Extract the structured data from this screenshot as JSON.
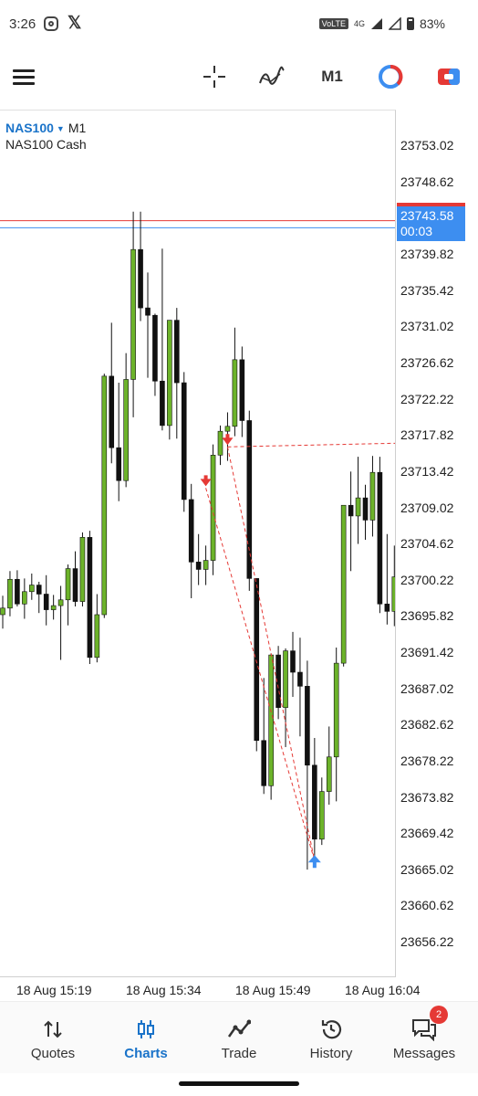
{
  "status_bar": {
    "time": "3:26",
    "network": "4G",
    "volte": "VoLTE",
    "battery": "83%"
  },
  "toolbar": {
    "timeframe": "M1"
  },
  "chart_header": {
    "symbol": "NAS100",
    "timeframe": "M1",
    "description": "NAS100 Cash"
  },
  "price_scale": {
    "labels": [
      "23753.02",
      "23748.62",
      "23739.82",
      "23735.42",
      "23731.02",
      "23726.62",
      "23722.22",
      "23717.82",
      "23713.42",
      "23709.02",
      "23704.62",
      "23700.22",
      "23695.82",
      "23691.42",
      "23687.02",
      "23682.62",
      "23678.22",
      "23673.82",
      "23669.42",
      "23665.02",
      "23660.62",
      "23656.22"
    ],
    "current_price": "23743.58",
    "countdown": "00:03"
  },
  "time_axis": {
    "labels": [
      "18 Aug 15:19",
      "18 Aug 15:34",
      "18 Aug 15:49",
      "18 Aug 16:04"
    ]
  },
  "colors": {
    "bull": "#6cb32a",
    "bear": "#111111",
    "ask_line": "#e53935",
    "bid_line": "#3d8ef0",
    "trade_line": "#e53935",
    "buy_arrow": "#3d8ef0",
    "sell_arrow": "#e53935",
    "accent": "#1a73c9"
  },
  "chart_data": {
    "type": "candlestick",
    "y_axis": {
      "min": 23652.0,
      "max": 23757.5
    },
    "ask_price": 23744.0,
    "bid_price": 23743.58,
    "candles": [
      {
        "o": 23696.2,
        "h": 23698.5,
        "l": 23694.5,
        "c": 23697.0
      },
      {
        "o": 23697.0,
        "h": 23701.5,
        "l": 23696.0,
        "c": 23700.5
      },
      {
        "o": 23700.5,
        "h": 23701.6,
        "l": 23697.2,
        "c": 23697.5
      },
      {
        "o": 23697.5,
        "h": 23700.6,
        "l": 23695.7,
        "c": 23699.0
      },
      {
        "o": 23699.0,
        "h": 23701.2,
        "l": 23698.0,
        "c": 23699.8
      },
      {
        "o": 23699.8,
        "h": 23700.2,
        "l": 23696.4,
        "c": 23698.7
      },
      {
        "o": 23698.7,
        "h": 23701.0,
        "l": 23694.9,
        "c": 23696.8
      },
      {
        "o": 23696.8,
        "h": 23698.6,
        "l": 23695.6,
        "c": 23697.3
      },
      {
        "o": 23697.3,
        "h": 23699.7,
        "l": 23690.7,
        "c": 23698.0
      },
      {
        "o": 23698.0,
        "h": 23702.3,
        "l": 23694.9,
        "c": 23701.8
      },
      {
        "o": 23701.8,
        "h": 23703.9,
        "l": 23697.2,
        "c": 23697.8
      },
      {
        "o": 23697.8,
        "h": 23706.2,
        "l": 23697.2,
        "c": 23705.6
      },
      {
        "o": 23705.6,
        "h": 23706.4,
        "l": 23690.2,
        "c": 23691.0
      },
      {
        "o": 23691.0,
        "h": 23698.7,
        "l": 23690.4,
        "c": 23696.2
      },
      {
        "o": 23696.2,
        "h": 23725.5,
        "l": 23695.8,
        "c": 23725.2
      },
      {
        "o": 23725.2,
        "h": 23731.7,
        "l": 23714.6,
        "c": 23716.5
      },
      {
        "o": 23716.5,
        "h": 23724.4,
        "l": 23710.0,
        "c": 23712.5
      },
      {
        "o": 23712.5,
        "h": 23728.0,
        "l": 23711.7,
        "c": 23724.8
      },
      {
        "o": 23724.8,
        "h": 23745.2,
        "l": 23720.2,
        "c": 23740.6
      },
      {
        "o": 23740.6,
        "h": 23745.2,
        "l": 23731.9,
        "c": 23733.5
      },
      {
        "o": 23733.5,
        "h": 23737.8,
        "l": 23725.0,
        "c": 23732.6
      },
      {
        "o": 23732.6,
        "h": 23732.8,
        "l": 23722.8,
        "c": 23724.6
      },
      {
        "o": 23724.6,
        "h": 23740.7,
        "l": 23718.6,
        "c": 23719.2
      },
      {
        "o": 23719.2,
        "h": 23731.2,
        "l": 23717.5,
        "c": 23732.0
      },
      {
        "o": 23732.0,
        "h": 23733.5,
        "l": 23717.6,
        "c": 23724.4
      },
      {
        "o": 23724.4,
        "h": 23725.7,
        "l": 23708.7,
        "c": 23710.2
      },
      {
        "o": 23710.2,
        "h": 23712.1,
        "l": 23698.2,
        "c": 23702.6
      },
      {
        "o": 23702.6,
        "h": 23706.0,
        "l": 23699.8,
        "c": 23701.7
      },
      {
        "o": 23701.7,
        "h": 23704.6,
        "l": 23699.8,
        "c": 23702.8
      },
      {
        "o": 23702.8,
        "h": 23716.9,
        "l": 23701.0,
        "c": 23715.6
      },
      {
        "o": 23715.6,
        "h": 23719.2,
        "l": 23714.4,
        "c": 23718.5
      },
      {
        "o": 23718.5,
        "h": 23720.8,
        "l": 23714.9,
        "c": 23719.1
      },
      {
        "o": 23719.1,
        "h": 23731.1,
        "l": 23717.9,
        "c": 23727.2
      },
      {
        "o": 23727.2,
        "h": 23728.8,
        "l": 23717.8,
        "c": 23719.8
      },
      {
        "o": 23719.8,
        "h": 23721.0,
        "l": 23699.1,
        "c": 23700.6
      },
      {
        "o": 23700.6,
        "h": 23698.6,
        "l": 23679.6,
        "c": 23680.9
      },
      {
        "o": 23680.9,
        "h": 23688.5,
        "l": 23674.4,
        "c": 23675.4
      },
      {
        "o": 23675.4,
        "h": 23691.5,
        "l": 23673.7,
        "c": 23691.3
      },
      {
        "o": 23691.3,
        "h": 23692.4,
        "l": 23683.5,
        "c": 23684.9
      },
      {
        "o": 23684.9,
        "h": 23692.1,
        "l": 23680.1,
        "c": 23691.8
      },
      {
        "o": 23691.8,
        "h": 23694.1,
        "l": 23686.2,
        "c": 23689.2
      },
      {
        "o": 23689.2,
        "h": 23693.4,
        "l": 23681.4,
        "c": 23687.5
      },
      {
        "o": 23687.5,
        "h": 23690.6,
        "l": 23665.2,
        "c": 23677.9
      },
      {
        "o": 23677.9,
        "h": 23681.2,
        "l": 23666.0,
        "c": 23668.9
      },
      {
        "o": 23668.9,
        "h": 23676.4,
        "l": 23668.2,
        "c": 23674.7
      },
      {
        "o": 23674.7,
        "h": 23682.6,
        "l": 23673.1,
        "c": 23678.9
      },
      {
        "o": 23678.9,
        "h": 23692.2,
        "l": 23673.5,
        "c": 23690.3
      },
      {
        "o": 23690.3,
        "h": 23705.2,
        "l": 23689.9,
        "c": 23709.5
      },
      {
        "o": 23709.5,
        "h": 23713.6,
        "l": 23701.5,
        "c": 23708.2
      },
      {
        "o": 23708.2,
        "h": 23715.4,
        "l": 23704.8,
        "c": 23710.4
      },
      {
        "o": 23710.4,
        "h": 23712.0,
        "l": 23705.3,
        "c": 23707.7
      },
      {
        "o": 23707.7,
        "h": 23715.5,
        "l": 23705.7,
        "c": 23713.5
      },
      {
        "o": 23713.5,
        "h": 23715.4,
        "l": 23696.4,
        "c": 23697.5
      },
      {
        "o": 23697.5,
        "h": 23706.0,
        "l": 23695.0,
        "c": 23696.6
      },
      {
        "o": 23696.6,
        "h": 23704.6,
        "l": 23694.8,
        "c": 23700.8
      }
    ],
    "trades": [
      {
        "type": "sell",
        "candle": 28,
        "price": 23711.6
      },
      {
        "type": "sell",
        "candle": 31,
        "price": 23716.6
      },
      {
        "type": "buy",
        "candle": 43,
        "price": 23666.3
      }
    ]
  }
}
